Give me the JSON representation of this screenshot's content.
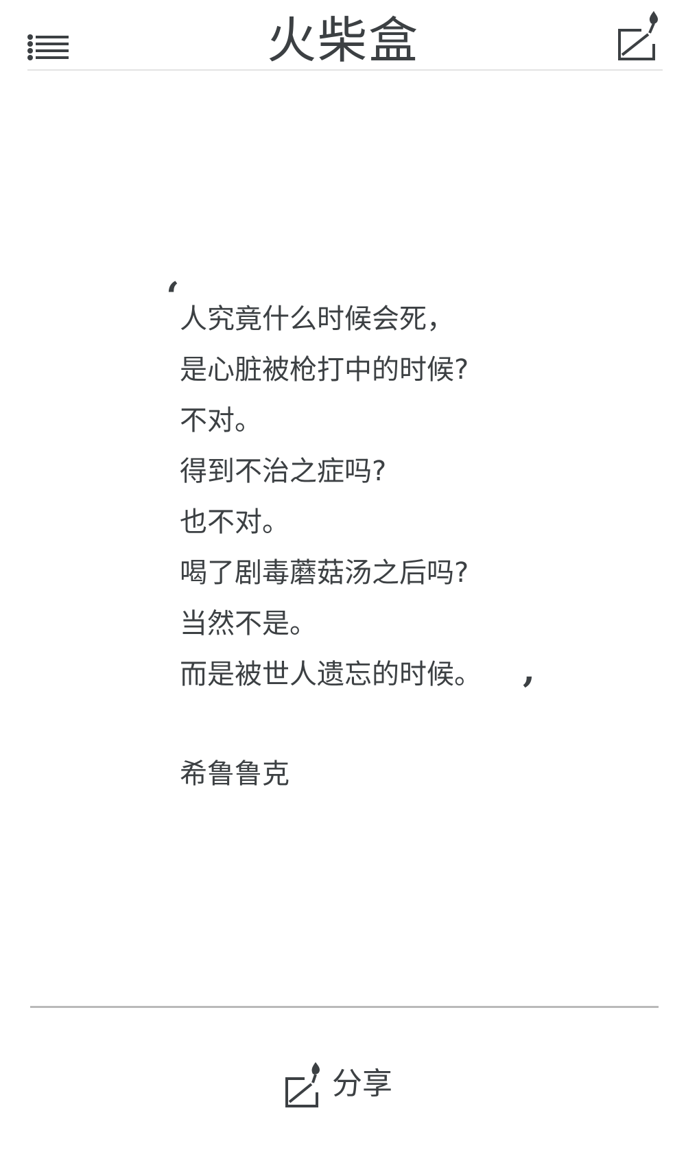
{
  "header": {
    "title": "火柴盒"
  },
  "quote": {
    "open_mark": "‘",
    "close_mark": "’",
    "lines": [
      "人究竟什么时候会死，",
      "是心脏被枪打中的时候?",
      "不对。",
      "得到不治之症吗?",
      "也不对。",
      "喝了剧毒蘑菇汤之后吗?",
      "当然不是。",
      "而是被世人遗忘的时候。"
    ],
    "author": "希鲁鲁克"
  },
  "footer": {
    "share_label": "分享"
  },
  "icons": {
    "menu": "menu-list-icon",
    "compose": "compose-match-icon",
    "share": "share-match-icon"
  },
  "colors": {
    "text": "#3c4043",
    "divider": "#b9b9b9",
    "background": "#ffffff"
  }
}
